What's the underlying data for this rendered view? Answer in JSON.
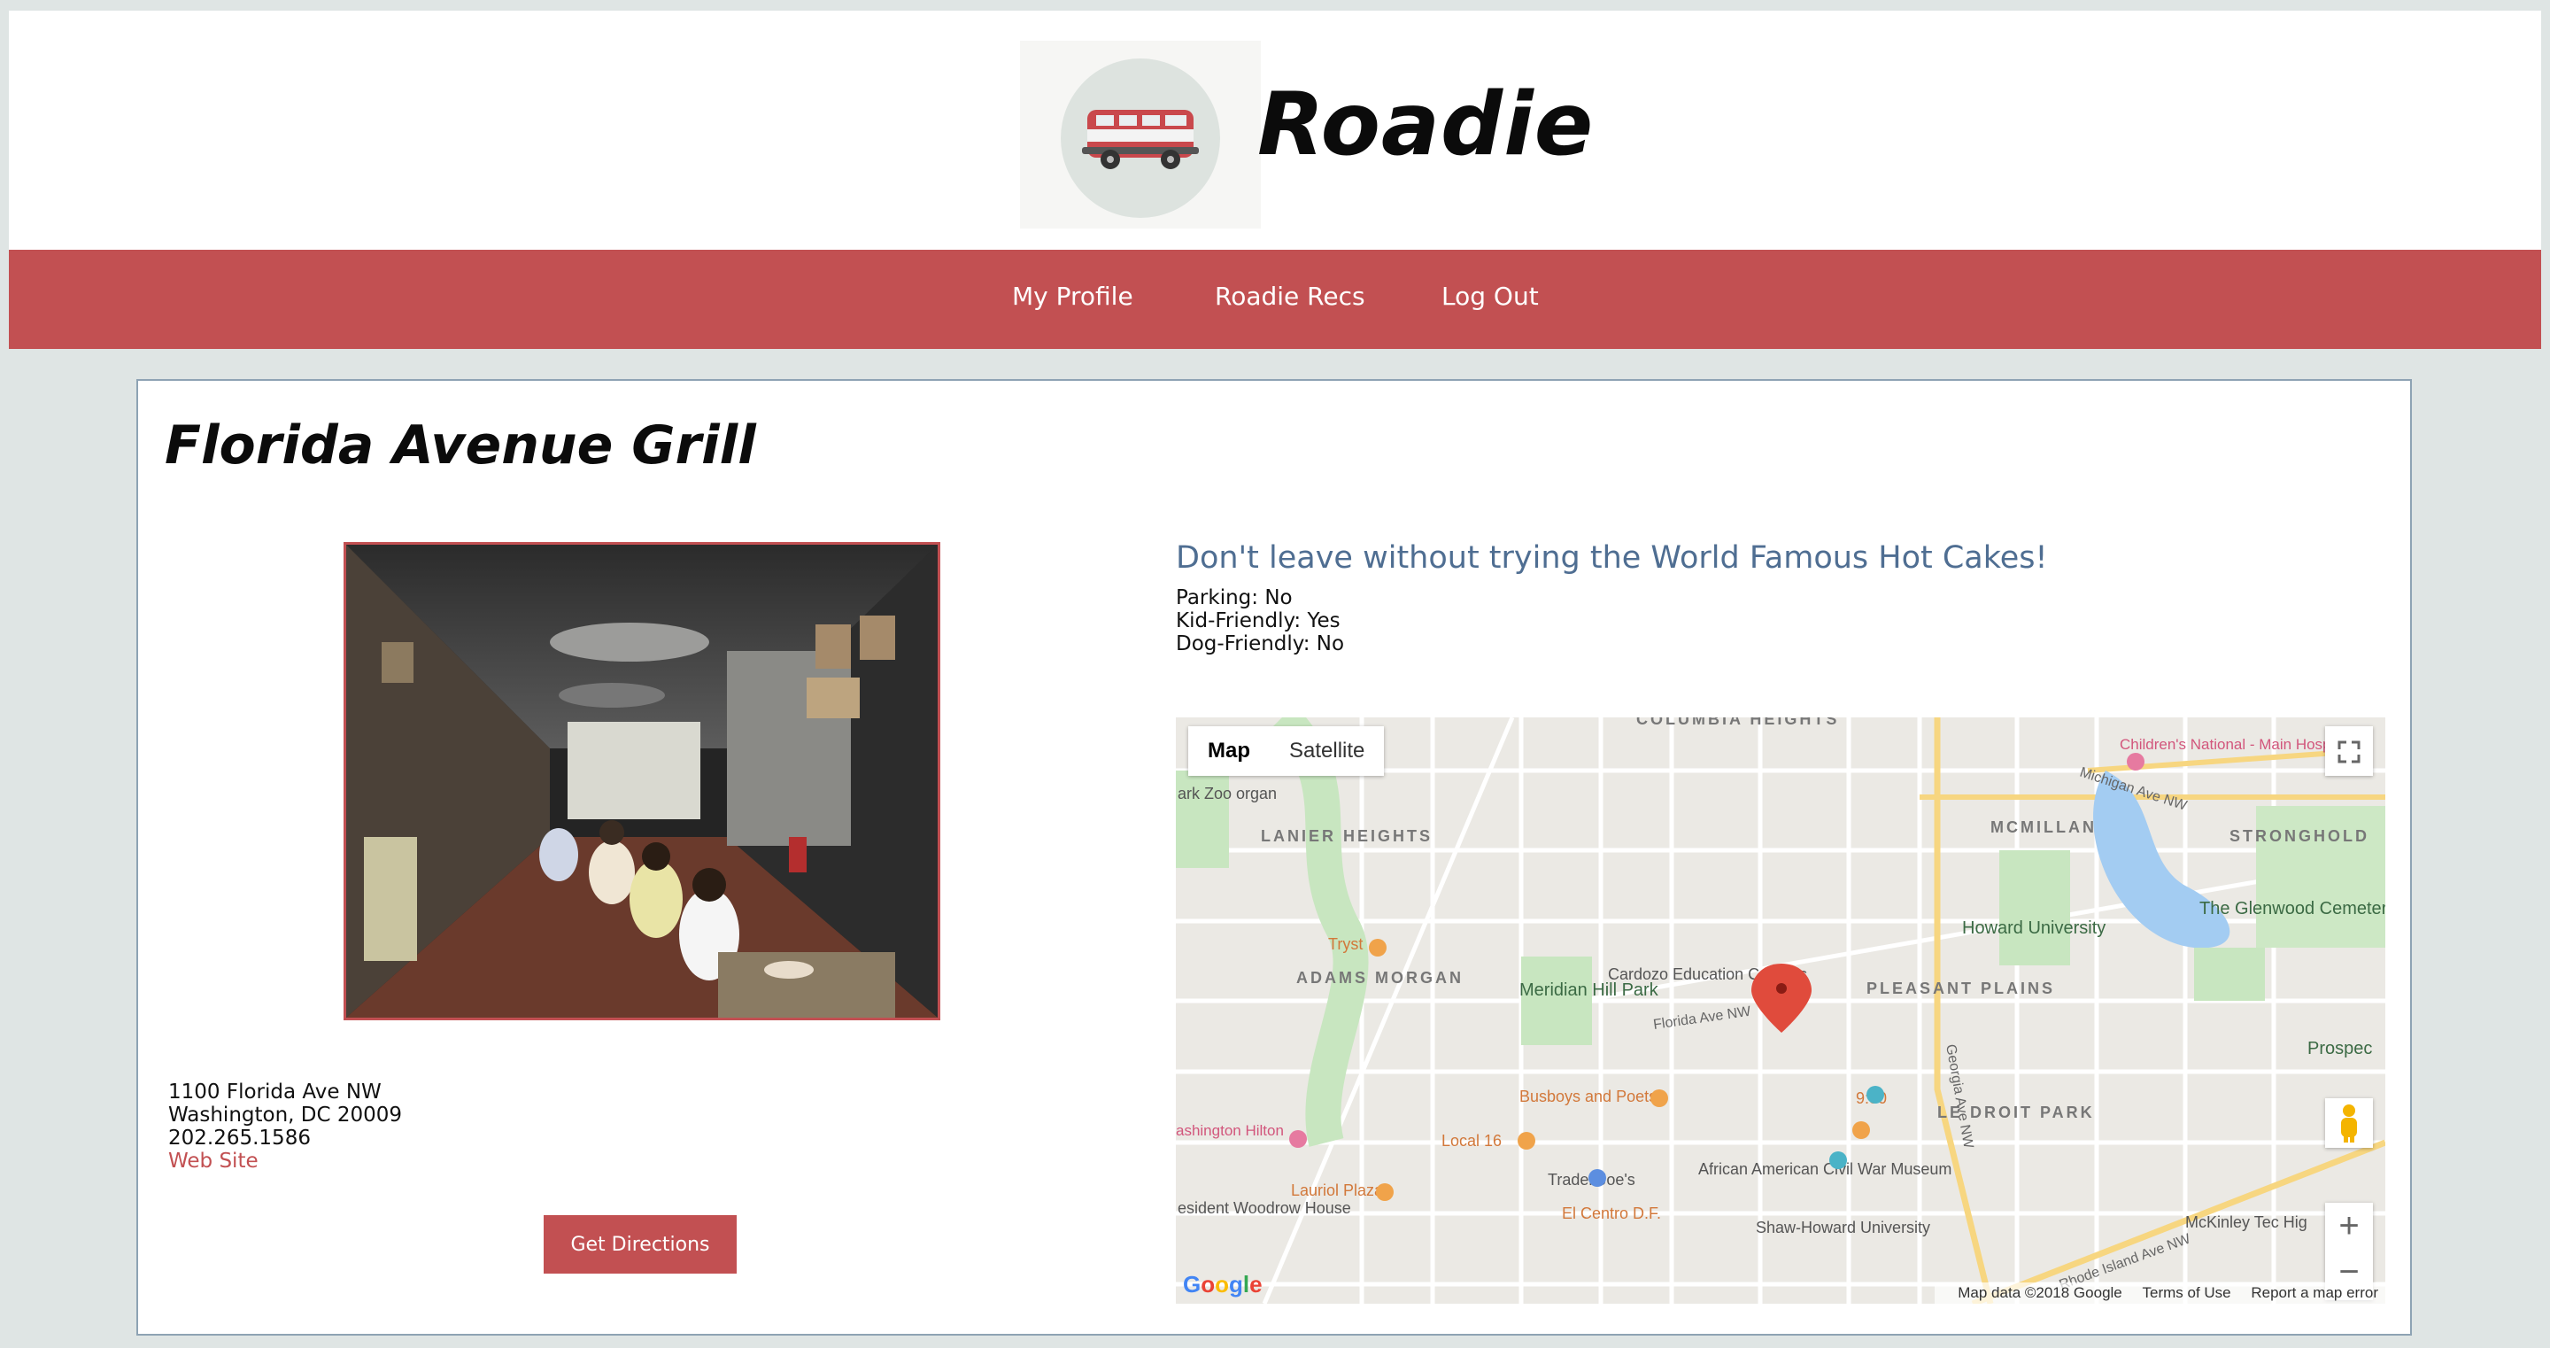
{
  "brand": {
    "name": "Roadie"
  },
  "nav": {
    "items": [
      "My Profile",
      "Roadie Recs",
      "Log Out"
    ]
  },
  "place": {
    "name": "Florida Avenue Grill",
    "tagline": "Don't leave without trying the World Famous Hot Cakes!",
    "attributes": [
      "Parking: No",
      "Kid-Friendly: Yes",
      "Dog-Friendly: No"
    ],
    "address_line1": "1100 Florida Ave NW",
    "address_line2": "Washington, DC 20009",
    "phone": "202.265.1586",
    "website_label": "Web Site",
    "directions_button": "Get Directions"
  },
  "map": {
    "type_map": "Map",
    "type_satellite": "Satellite",
    "zoom_in": "+",
    "zoom_out": "−",
    "footer_data": "Map data ©2018 Google",
    "footer_terms": "Terms of Use",
    "footer_report": "Report a map error",
    "logo": "Google",
    "labels": {
      "columbia_heights": "COLUMBIA HEIGHTS",
      "lanier_heights": "LANIER HEIGHTS",
      "mcmillan": "MCMILLAN",
      "stronghold": "STRONGHOLD",
      "adams_morgan": "ADAMS MORGAN",
      "pleasant_plains": "PLEASANT PLAINS",
      "le_droit_park": "LE DROIT PARK",
      "howard_university": "Howard University",
      "childrens_national": "Children's National - Main Hospital",
      "glenwood": "The Glenwood Cemetery",
      "cardozo": "Cardozo Education Campus",
      "meridian": "Meridian Hill Park",
      "tryst": "Tryst",
      "busboys": "Busboys and Poets",
      "local16": "Local 16",
      "traderjoes": "Trader Joe's",
      "lauriol": "Lauriol Plaza",
      "elcentro": "El Centro D.F.",
      "african_american": "African American Civil War Museum",
      "shaw_howard": "Shaw-Howard University",
      "nine_thirty": "9:30",
      "hilton": "ashington Hilton",
      "woodrow": "esident Woodrow House",
      "zoo": "ark Zoo organ",
      "rhode_island": "Rhode Island Ave NW",
      "georgia": "Georgia Ave NW",
      "michigan": "Michigan Ave NW",
      "florida": "Florida Ave NW",
      "mckinley": "McKinley Tec Hig",
      "prospect": "Prospec"
    }
  },
  "colors": {
    "accent": "#c25052",
    "tagline": "#4f6e92",
    "background": "#dfe5e4"
  }
}
